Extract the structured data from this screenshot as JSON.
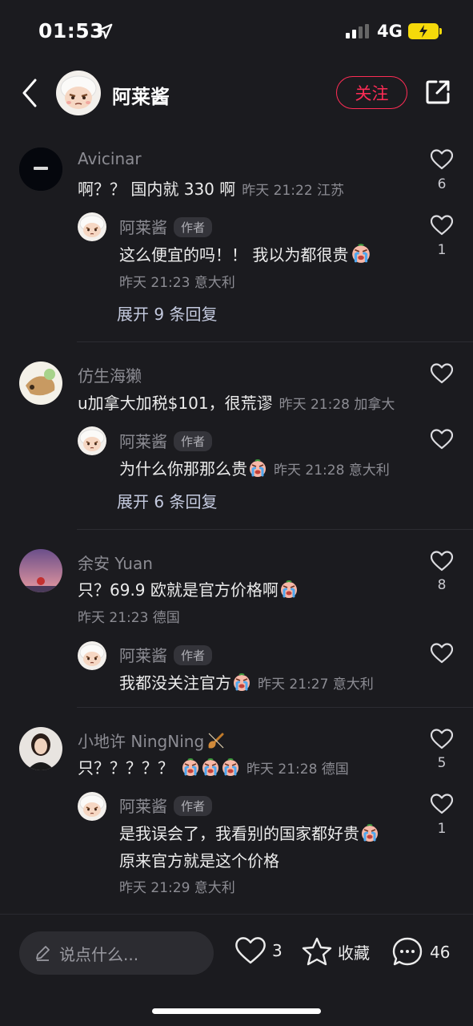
{
  "status_bar": {
    "time": "01:53",
    "network": "4G"
  },
  "header": {
    "name": "阿莱酱",
    "follow_label": "关注"
  },
  "comments": [
    {
      "name": "Avicinar",
      "text": "啊？？ 国内就 330 啊",
      "meta": "昨天 21:22 江苏",
      "likes": "6",
      "reply": {
        "name": "阿莱酱",
        "tag": "作者",
        "text": "这么便宜的吗！！ 我以为都很贵",
        "meta": "昨天 21:23 意大利",
        "likes": "1"
      },
      "expand": "展开 9 条回复"
    },
    {
      "name": "仿生海獭",
      "text": "u加拿大加税$101，很荒谬",
      "meta": "昨天 21:28 加拿大",
      "likes": "",
      "reply": {
        "name": "阿莱酱",
        "tag": "作者",
        "text": "为什么你那那么贵",
        "meta": "昨天 21:28 意大利",
        "likes": ""
      },
      "expand": "展开 6 条回复"
    },
    {
      "name": "余安 Yuan",
      "text": "只？69.9 欧就是官方价格啊",
      "meta": "昨天 21:23 德国",
      "likes": "8",
      "reply": {
        "name": "阿莱酱",
        "tag": "作者",
        "text": "我都没关注官方",
        "meta": "昨天 21:27 意大利",
        "likes": ""
      }
    },
    {
      "name": "小地许 NingNing",
      "text": "只？？？？？",
      "meta": "昨天 21:28 德国",
      "likes": "5",
      "reply": {
        "name": "阿莱酱",
        "tag": "作者",
        "text": "是我误会了，我看别的国家都好贵",
        "text2": "原来官方就是这个价格",
        "meta": "昨天 21:29 意大利",
        "likes": "1"
      }
    }
  ],
  "bottom_bar": {
    "placeholder": "说点什么...",
    "likes": "3",
    "favorite_label": "收藏",
    "comments": "46"
  },
  "colors": {
    "background": "#1b1b1f",
    "accent": "#fe2c55",
    "muted": "#8c8c93"
  }
}
